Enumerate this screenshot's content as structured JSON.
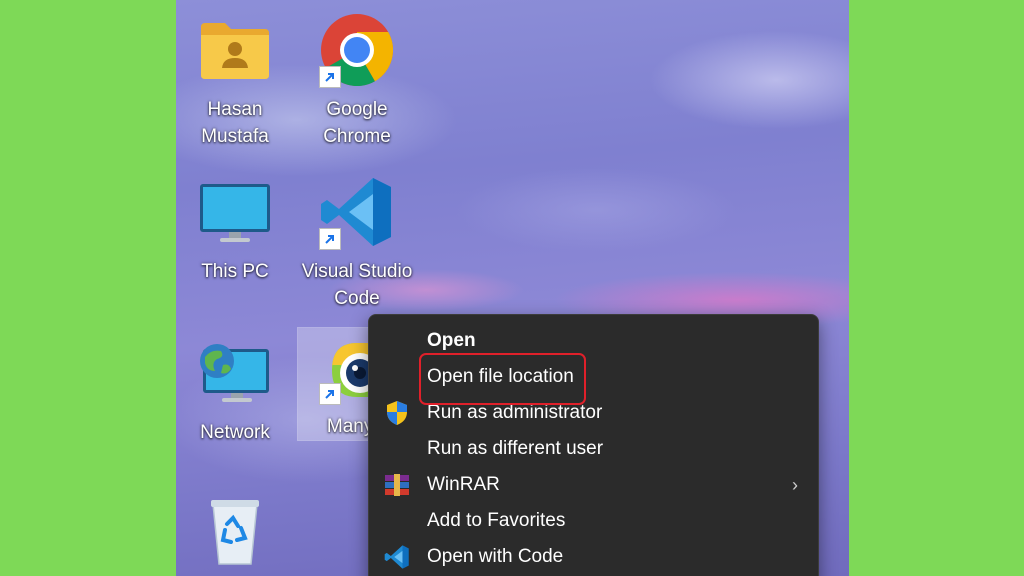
{
  "desktop": {
    "icons": [
      {
        "label": "Hasan\nMustafa",
        "icon": "user-folder-icon"
      },
      {
        "label": "Google\nChrome",
        "icon": "chrome-icon"
      },
      {
        "label": "This PC",
        "icon": "monitor-icon"
      },
      {
        "label": "Visual Studio\nCode",
        "icon": "vscode-icon"
      },
      {
        "label": "Network",
        "icon": "network-icon"
      },
      {
        "label": "ManyC",
        "icon": "manycam-icon"
      },
      {
        "label": "",
        "icon": "recycle-bin-icon"
      }
    ]
  },
  "context_menu": {
    "items": [
      {
        "label": "Open",
        "icon": ""
      },
      {
        "label": "Open file location",
        "icon": ""
      },
      {
        "label": "Run as administrator",
        "icon": "uac-shield-icon"
      },
      {
        "label": "Run as different user",
        "icon": ""
      },
      {
        "label": "WinRAR",
        "icon": "winrar-icon",
        "submenu_arrow": "›"
      },
      {
        "label": "Add to Favorites",
        "icon": ""
      },
      {
        "label": "Open with Code",
        "icon": "vscode-icon"
      }
    ],
    "highlighted_item": "Open file location",
    "highlight_color": "#e0202a"
  },
  "colors": {
    "page_background": "#7ed957",
    "menu_background": "#2b2b2b"
  }
}
